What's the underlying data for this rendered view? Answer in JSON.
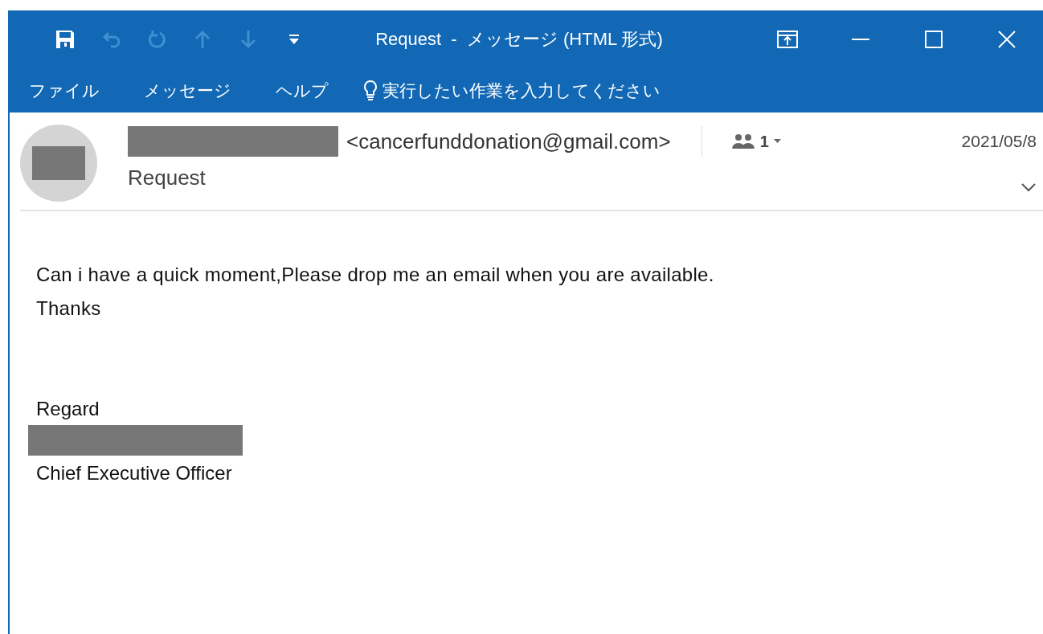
{
  "window": {
    "title": "Request  -  メッセージ (HTML 形式)"
  },
  "quick_access": [
    {
      "kind": "save",
      "disabled": false
    },
    {
      "kind": "undo",
      "disabled": true
    },
    {
      "kind": "redo",
      "disabled": true
    },
    {
      "kind": "up",
      "disabled": true
    },
    {
      "kind": "down",
      "disabled": true
    },
    {
      "kind": "customize",
      "disabled": false
    }
  ],
  "menu": [
    {
      "label": "ファイル"
    },
    {
      "label": "メッセージ"
    },
    {
      "label": "ヘルプ"
    }
  ],
  "tell_me": {
    "placeholder": "実行したい作業を入力してください"
  },
  "header": {
    "sender_email": "<cancerfunddonation@gmail.com>",
    "recipients_count": "1",
    "date": "2021/05/8",
    "subject": "Request"
  },
  "body": {
    "paragraph": "Can i have a quick moment,Please drop me an email when you are available. Thanks",
    "closing": "Regard",
    "signature_title": "Chief Executive Officer"
  }
}
